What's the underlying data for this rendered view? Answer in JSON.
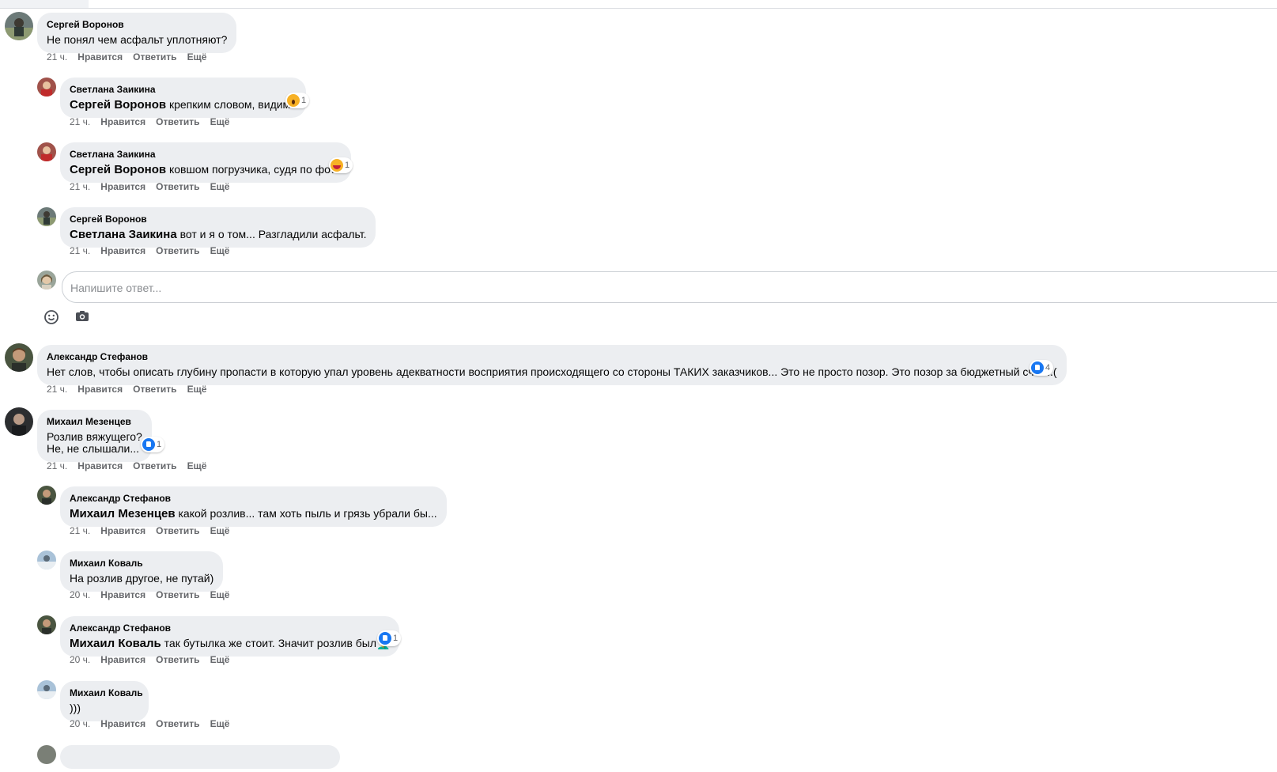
{
  "actions": {
    "time_21": "21 ч.",
    "time_20": "20 ч.",
    "like": "Нравится",
    "reply": "Ответить",
    "more": "Ещё"
  },
  "comments": [
    {
      "author": "Сергей Воронов",
      "text": "Не понял чем асфальт уплотняют?"
    },
    {
      "author": "Светлана Заикина",
      "mention": "Сергей Воронов",
      "text": " крепким словом, видимо",
      "reaction": {
        "type": "wow",
        "count": "1"
      }
    },
    {
      "author": "Светлана Заикина",
      "mention": "Сергей Воронов",
      "text": " ковшом погрузчика, судя по фото",
      "reaction": {
        "type": "haha",
        "count": "1"
      }
    },
    {
      "author": "Сергей Воронов",
      "mention": "Светлана Заикина",
      "text": " вот и я о том... Разгладили асфальт."
    },
    {
      "author": "Александр Стефанов",
      "text": "Нет слов, чтобы описать глубину пропасти в которую упал уровень адекватности восприятия происходящего со стороны ТАКИХ заказчиков... Это не просто позор. Это позор за бюджетный счёт...(",
      "reaction": {
        "type": "like",
        "count": "4"
      }
    },
    {
      "author": "Михаил Мезенцев",
      "text_line1": "Розлив вяжущего?",
      "text_line2": "Не, не слышали...",
      "reaction": {
        "type": "like",
        "count": "1"
      }
    },
    {
      "author": "Александр Стефанов",
      "mention": "Михаил Мезенцев",
      "text": " какой розлив... там хоть пыль и грязь убрали бы..."
    },
    {
      "author": "Михаил Коваль",
      "text": "На розлив другое, не путай)"
    },
    {
      "author": "Александр Стефанов",
      "mention": "Михаил Коваль",
      "text": " так бутылка же стоит. Значит розлив был🤦‍♂️",
      "reaction": {
        "type": "like",
        "count": "1"
      }
    },
    {
      "author": "Михаил Коваль",
      "text": ")))"
    }
  ],
  "reply_box": {
    "placeholder": "Напишите ответ..."
  },
  "icons": {
    "emoji": "emoji-icon",
    "camera": "camera-icon"
  },
  "colors": {
    "bubble": "#eceef1",
    "like_blue": "#1877f2",
    "meta_gray": "#65676b"
  }
}
